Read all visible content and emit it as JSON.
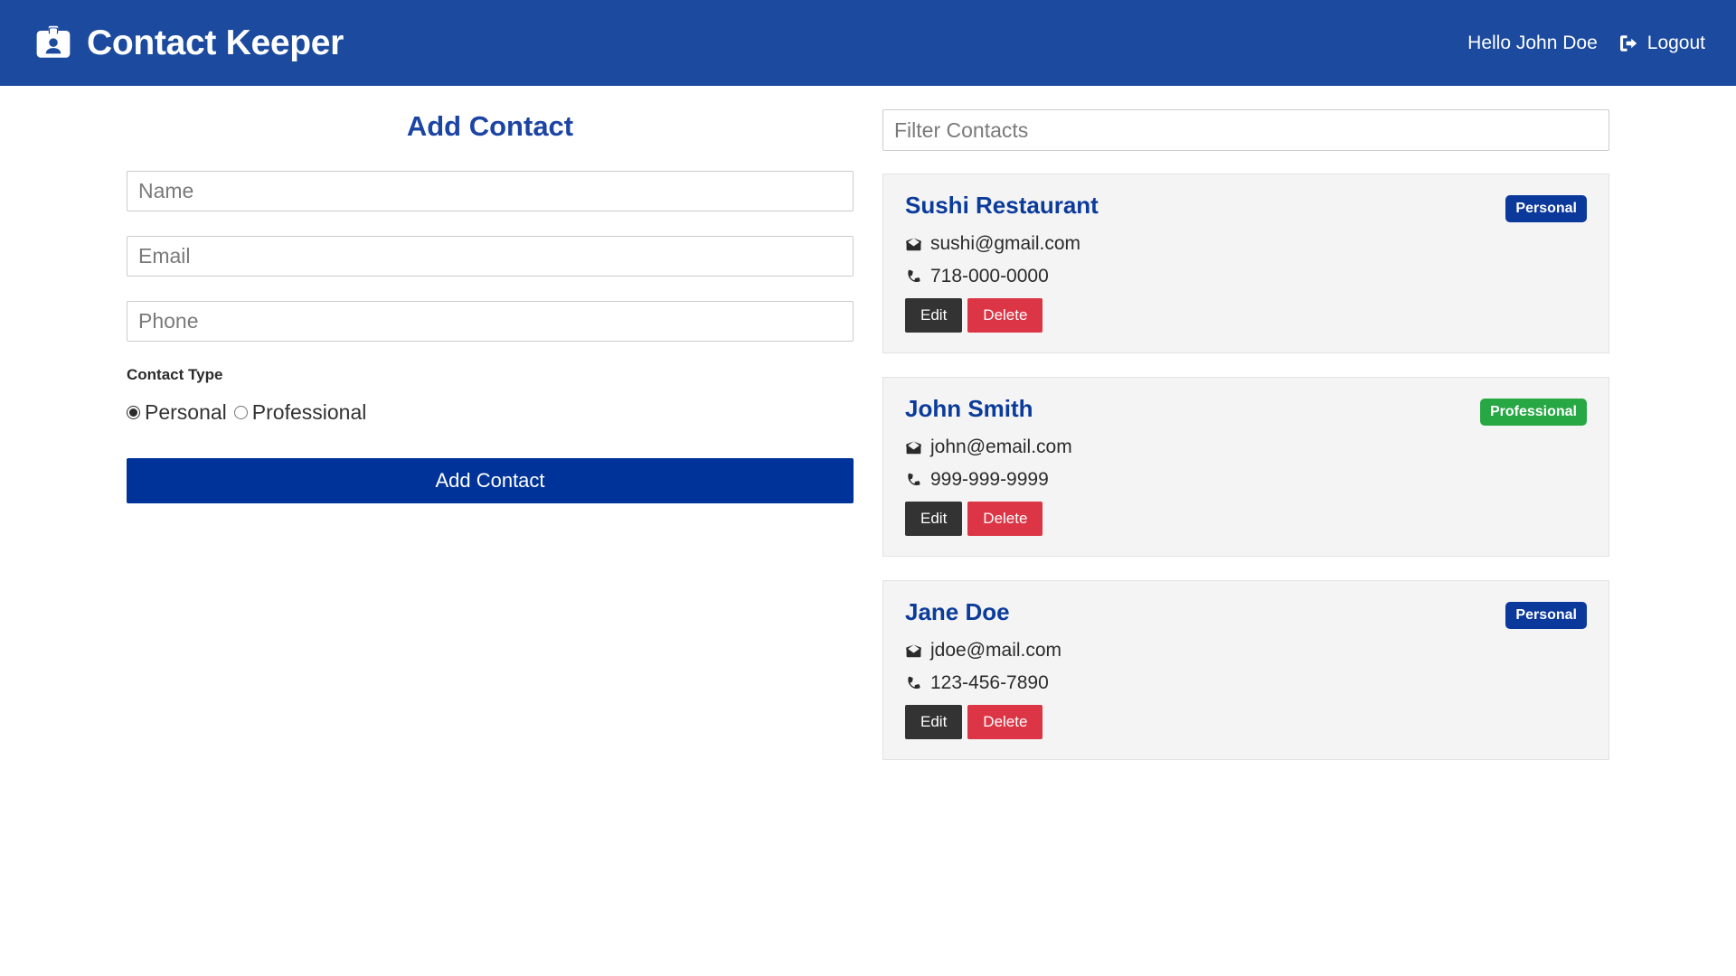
{
  "navbar": {
    "brand_title": "Contact Keeper",
    "brand_icon": "id-badge-icon",
    "greeting": "Hello John Doe",
    "logout_label": "Logout",
    "logout_icon": "sign-out-icon",
    "background_color": "#1b4a9e"
  },
  "form": {
    "title": "Add Contact",
    "name_placeholder": "Name",
    "name_value": "",
    "email_placeholder": "Email",
    "email_value": "",
    "phone_placeholder": "Phone",
    "phone_value": "",
    "contact_type_label": "Contact Type",
    "radio_personal_label": "Personal",
    "radio_professional_label": "Professional",
    "selected_type": "Personal",
    "submit_label": "Add Contact",
    "submit_color": "#003399",
    "title_color": "#1b44a4"
  },
  "contacts_panel": {
    "filter_placeholder": "Filter Contacts",
    "filter_value": "",
    "edit_label": "Edit",
    "delete_label": "Delete",
    "email_icon": "envelope-icon",
    "phone_icon": "phone-icon",
    "personal_color": "#0b389b",
    "professional_color": "#28a745",
    "edit_color": "#333333",
    "delete_color": "#dc3545",
    "items": [
      {
        "name": "Sushi Restaurant",
        "type": "Personal",
        "email": "sushi@gmail.com",
        "phone": "718-000-0000"
      },
      {
        "name": "John Smith",
        "type": "Professional",
        "email": "john@email.com",
        "phone": "999-999-9999"
      },
      {
        "name": "Jane Doe",
        "type": "Personal",
        "email": "jdoe@mail.com",
        "phone": "123-456-7890"
      }
    ]
  }
}
